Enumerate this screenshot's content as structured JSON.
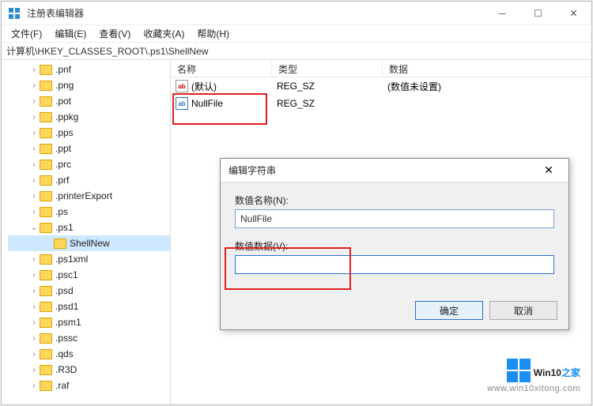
{
  "window": {
    "title": "注册表编辑器"
  },
  "menu": {
    "file": "文件(F)",
    "edit": "编辑(E)",
    "view": "查看(V)",
    "favorites": "收藏夹(A)",
    "help": "帮助(H)"
  },
  "path": "计算机\\HKEY_CLASSES_ROOT\\.ps1\\ShellNew",
  "tree": {
    "items": [
      ".pnf",
      ".png",
      ".pot",
      ".ppkg",
      ".pps",
      ".ppt",
      ".prc",
      ".prf",
      ".printerExport",
      ".ps",
      ".ps1"
    ],
    "expanded_child": "ShellNew",
    "items_after": [
      ".ps1xml",
      ".psc1",
      ".psd",
      ".psd1",
      ".psm1",
      ".pssc",
      ".qds",
      ".R3D",
      ".raf"
    ]
  },
  "list": {
    "columns": {
      "name": "名称",
      "type": "类型",
      "data": "数据"
    },
    "rows": [
      {
        "name": "(默认)",
        "type": "REG_SZ",
        "data": "(数值未设置)",
        "icon": "ab"
      },
      {
        "name": "NullFile",
        "type": "REG_SZ",
        "data": "",
        "icon": "ab-blue"
      }
    ]
  },
  "dialog": {
    "title": "编辑字符串",
    "name_label": "数值名称(N):",
    "name_value": "NullFile",
    "data_label": "数值数据(V):",
    "data_value": "",
    "ok": "确定",
    "cancel": "取消"
  },
  "watermark": {
    "brand_a": "Win10",
    "brand_b": "之家",
    "url": "www.win10xitong.com"
  }
}
